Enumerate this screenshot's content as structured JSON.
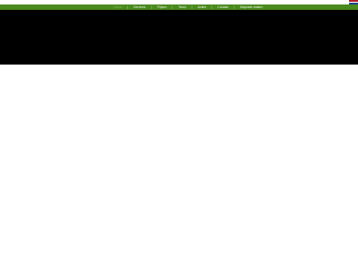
{
  "nav": {
    "items": [
      {
        "label": "Home",
        "active": true
      },
      {
        "label": "Services"
      },
      {
        "label": "Prijzen"
      },
      {
        "label": "Team"
      },
      {
        "label": "Acties"
      },
      {
        "label": "Contact"
      },
      {
        "label": "Afspraak maken"
      }
    ],
    "separator": "|"
  },
  "colors": {
    "nav_background": "#4a8a1e",
    "hero_background": "#000000",
    "page_background": "#ffffff"
  },
  "flag_colors": [
    "#ae1c28",
    "#ffffff",
    "#21468b"
  ]
}
